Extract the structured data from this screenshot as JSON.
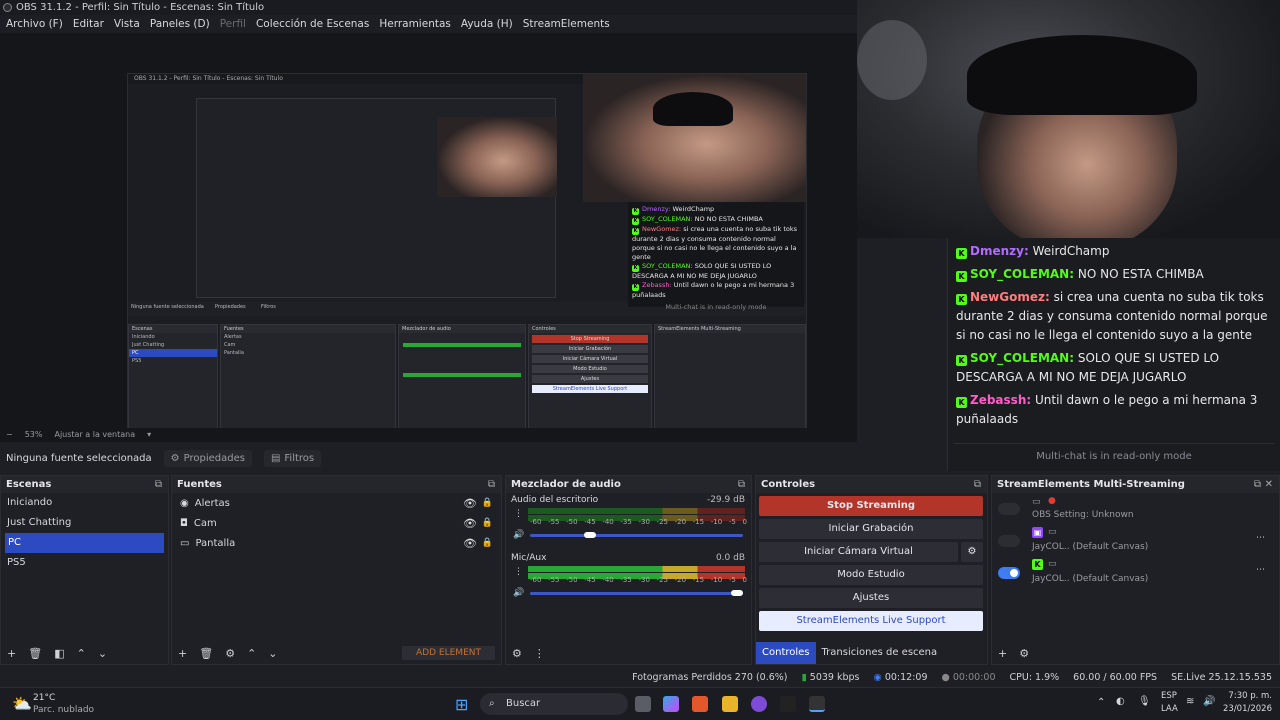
{
  "window": {
    "title": "OBS 31.1.2 - Perfil: Sin Título - Escenas: Sin Título"
  },
  "menu": [
    "Archivo (F)",
    "Editar",
    "Vista",
    "Paneles (D)",
    "Perfil",
    "Colección de Escenas",
    "Herramientas",
    "Ayuda (H)",
    "StreamElements"
  ],
  "nested": {
    "title": "OBS 31.1.2 - Perfil: Sin Título - Escenas: Sin Título",
    "scenes_head": "Escenas",
    "sources_head": "Fuentes",
    "mixer_head": "Mezclador de audio",
    "controls_head": "Controles",
    "se_head": "StreamElements Multi-Streaming",
    "scenes": [
      "Iniciando",
      "Just Chatting",
      "PC",
      "PS5"
    ],
    "sources": [
      "Alertas",
      "Cam",
      "Pantalla"
    ],
    "buttons": [
      "Stop Streaming",
      "Iniciar Grabación",
      "Iniciar Cámara Virtual",
      "Modo Estudio",
      "Ajustes",
      "StreamElements Live Support"
    ],
    "no_source": "Ninguna fuente seleccionada",
    "props": "Propiedades",
    "filters": "Filtros",
    "readonly": "Multi-chat is in read-only mode",
    "chat": [
      {
        "user": "Dmenzy:",
        "text": "WeirdChamp",
        "color": "#b36bff"
      },
      {
        "user": "SOY_COLEMAN:",
        "text": "NO NO ESTA CHIMBA",
        "color": "#53fc18"
      },
      {
        "user": "NewGomez:",
        "text": "si crea una cuenta no suba tik toks durante 2 dias y consuma contenido normal porque si no casi no le llega el contenido suyo a la gente",
        "color": "#ff7d7d"
      },
      {
        "user": "SOY_COLEMAN:",
        "text": "SOLO QUE SI USTED LO DESCARGA A MI NO ME DEJA JUGARLO",
        "color": "#53fc18"
      },
      {
        "user": "Zebassh:",
        "text": "Until dawn o le pego a mi hermana 3 puñalaads",
        "color": "#ff5cc8"
      }
    ]
  },
  "zoom": {
    "level": "53%",
    "fit": "Ajustar a la ventana"
  },
  "chat": {
    "messages": [
      {
        "user": "Dmenzy:",
        "text": "WeirdChamp",
        "color": "#b36bff"
      },
      {
        "user": "SOY_COLEMAN:",
        "text": "NO NO ESTA CHIMBA",
        "color": "#53fc18"
      },
      {
        "user": "NewGomez:",
        "text": "si crea una cuenta no suba tik toks durante 2 dias y consuma contenido normal porque si no casi no le llega el contenido suyo a la gente",
        "color": "#ff7d7d"
      },
      {
        "user": "SOY_COLEMAN:",
        "text": "SOLO QUE SI USTED LO DESCARGA A MI NO ME DEJA JUGARLO",
        "color": "#53fc18"
      },
      {
        "user": "Zebassh:",
        "text": "Until dawn o le pego a mi hermana 3 puñalaads",
        "color": "#ff5cc8"
      }
    ],
    "readonly": "Multi-chat is in read-only mode"
  },
  "source_bar": {
    "none": "Ninguna fuente seleccionada",
    "properties": "Propiedades",
    "filters": "Filtros"
  },
  "scenes": {
    "title": "Escenas",
    "items": [
      "Iniciando",
      "Just Chatting",
      "PC",
      "PS5"
    ],
    "selected": "PC"
  },
  "sources": {
    "title": "Fuentes",
    "items": [
      "Alertas",
      "Cam",
      "Pantalla"
    ],
    "add": "ADD ELEMENT"
  },
  "mixer": {
    "title": "Mezclador de audio",
    "channels": [
      {
        "name": "Audio del escritorio",
        "db": "-29.9 dB",
        "volume": 0.28
      },
      {
        "name": "Mic/Aux",
        "db": "0.0 dB",
        "volume": 1.0
      }
    ],
    "ticks": [
      "-60",
      "-55",
      "-50",
      "-45",
      "-40",
      "-35",
      "-30",
      "-25",
      "-20",
      "-15",
      "-10",
      "-5",
      "0"
    ]
  },
  "controls": {
    "title": "Controles",
    "stop": "Stop Streaming",
    "record": "Iniciar Grabación",
    "virtualcam": "Iniciar Cámara Virtual",
    "studio": "Modo Estudio",
    "settings": "Ajustes",
    "support": "StreamElements Live Support",
    "tab_controls": "Controles",
    "tab_transitions": "Transiciones de escena"
  },
  "se": {
    "title": "StreamElements Multi-Streaming",
    "rows": [
      {
        "label": "OBS Setting: Unknown",
        "on": false
      },
      {
        "label": "JayCOL.. (Default Canvas)",
        "on": false
      },
      {
        "label": "JayCOL.. (Default Canvas)",
        "on": true
      }
    ]
  },
  "status": {
    "dropped": "Fotogramas Perdidos 270 (0.6%)",
    "bitrate": "5039 kbps",
    "live": "00:12:09",
    "rec": "00:00:00",
    "cpu": "CPU: 1.9%",
    "fps": "60.00 / 60.00 FPS",
    "se": "SE.Live 25.12.15.535"
  },
  "taskbar": {
    "weather_temp": "21°C",
    "weather_desc": "Parc. nublado",
    "search": "Buscar",
    "lang": "ESP",
    "lang2": "LAA",
    "time": "7:30 p. m.",
    "date": "23/01/2026"
  }
}
